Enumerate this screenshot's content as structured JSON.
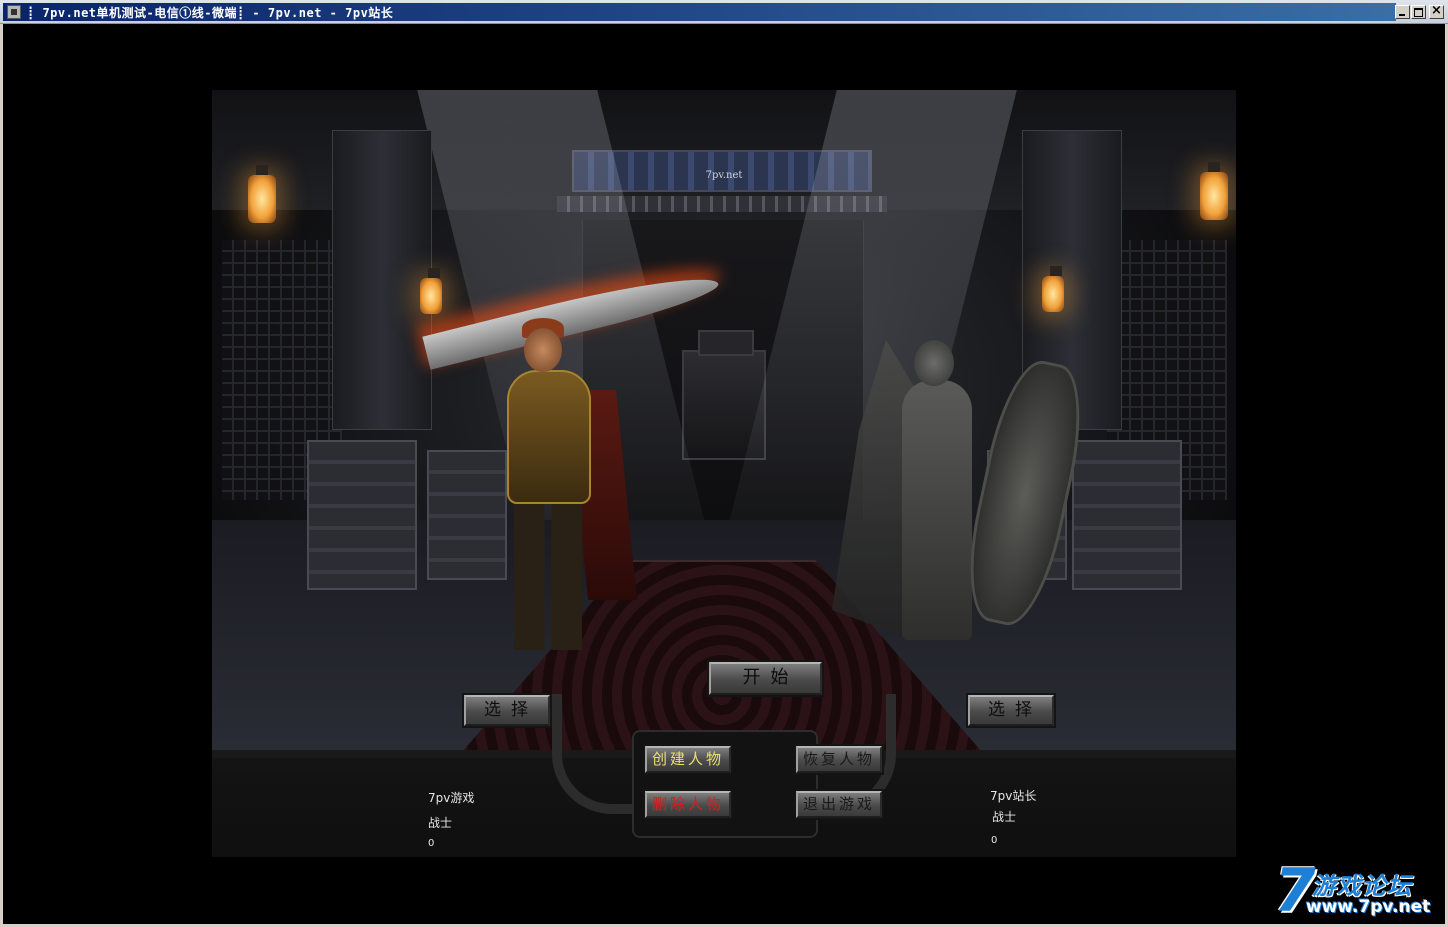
{
  "window": {
    "title": "┋ 7pv.net单机测试-电信①线-微端┋ - 7pv.net - 7pv站长",
    "buttons": [
      "minimize",
      "maximize",
      "close"
    ]
  },
  "game": {
    "server_label": "7pv.net",
    "buttons": {
      "start": "开始",
      "select_left": "选择",
      "select_right": "选择",
      "create": "创建人物",
      "restore": "恢复人物",
      "delete": "删除人物",
      "quit": "退出游戏"
    },
    "characters": [
      {
        "name": "7pv游戏",
        "job": "战士",
        "level": "0"
      },
      {
        "name": "7pv站长",
        "job": "战士",
        "level": "0"
      }
    ],
    "colors": {
      "create_text": "#e8e070",
      "delete_text": "#d22020"
    }
  },
  "watermark": {
    "logo_number": "7",
    "logo_text": "游戏论坛",
    "url": "www.7pv.net"
  }
}
